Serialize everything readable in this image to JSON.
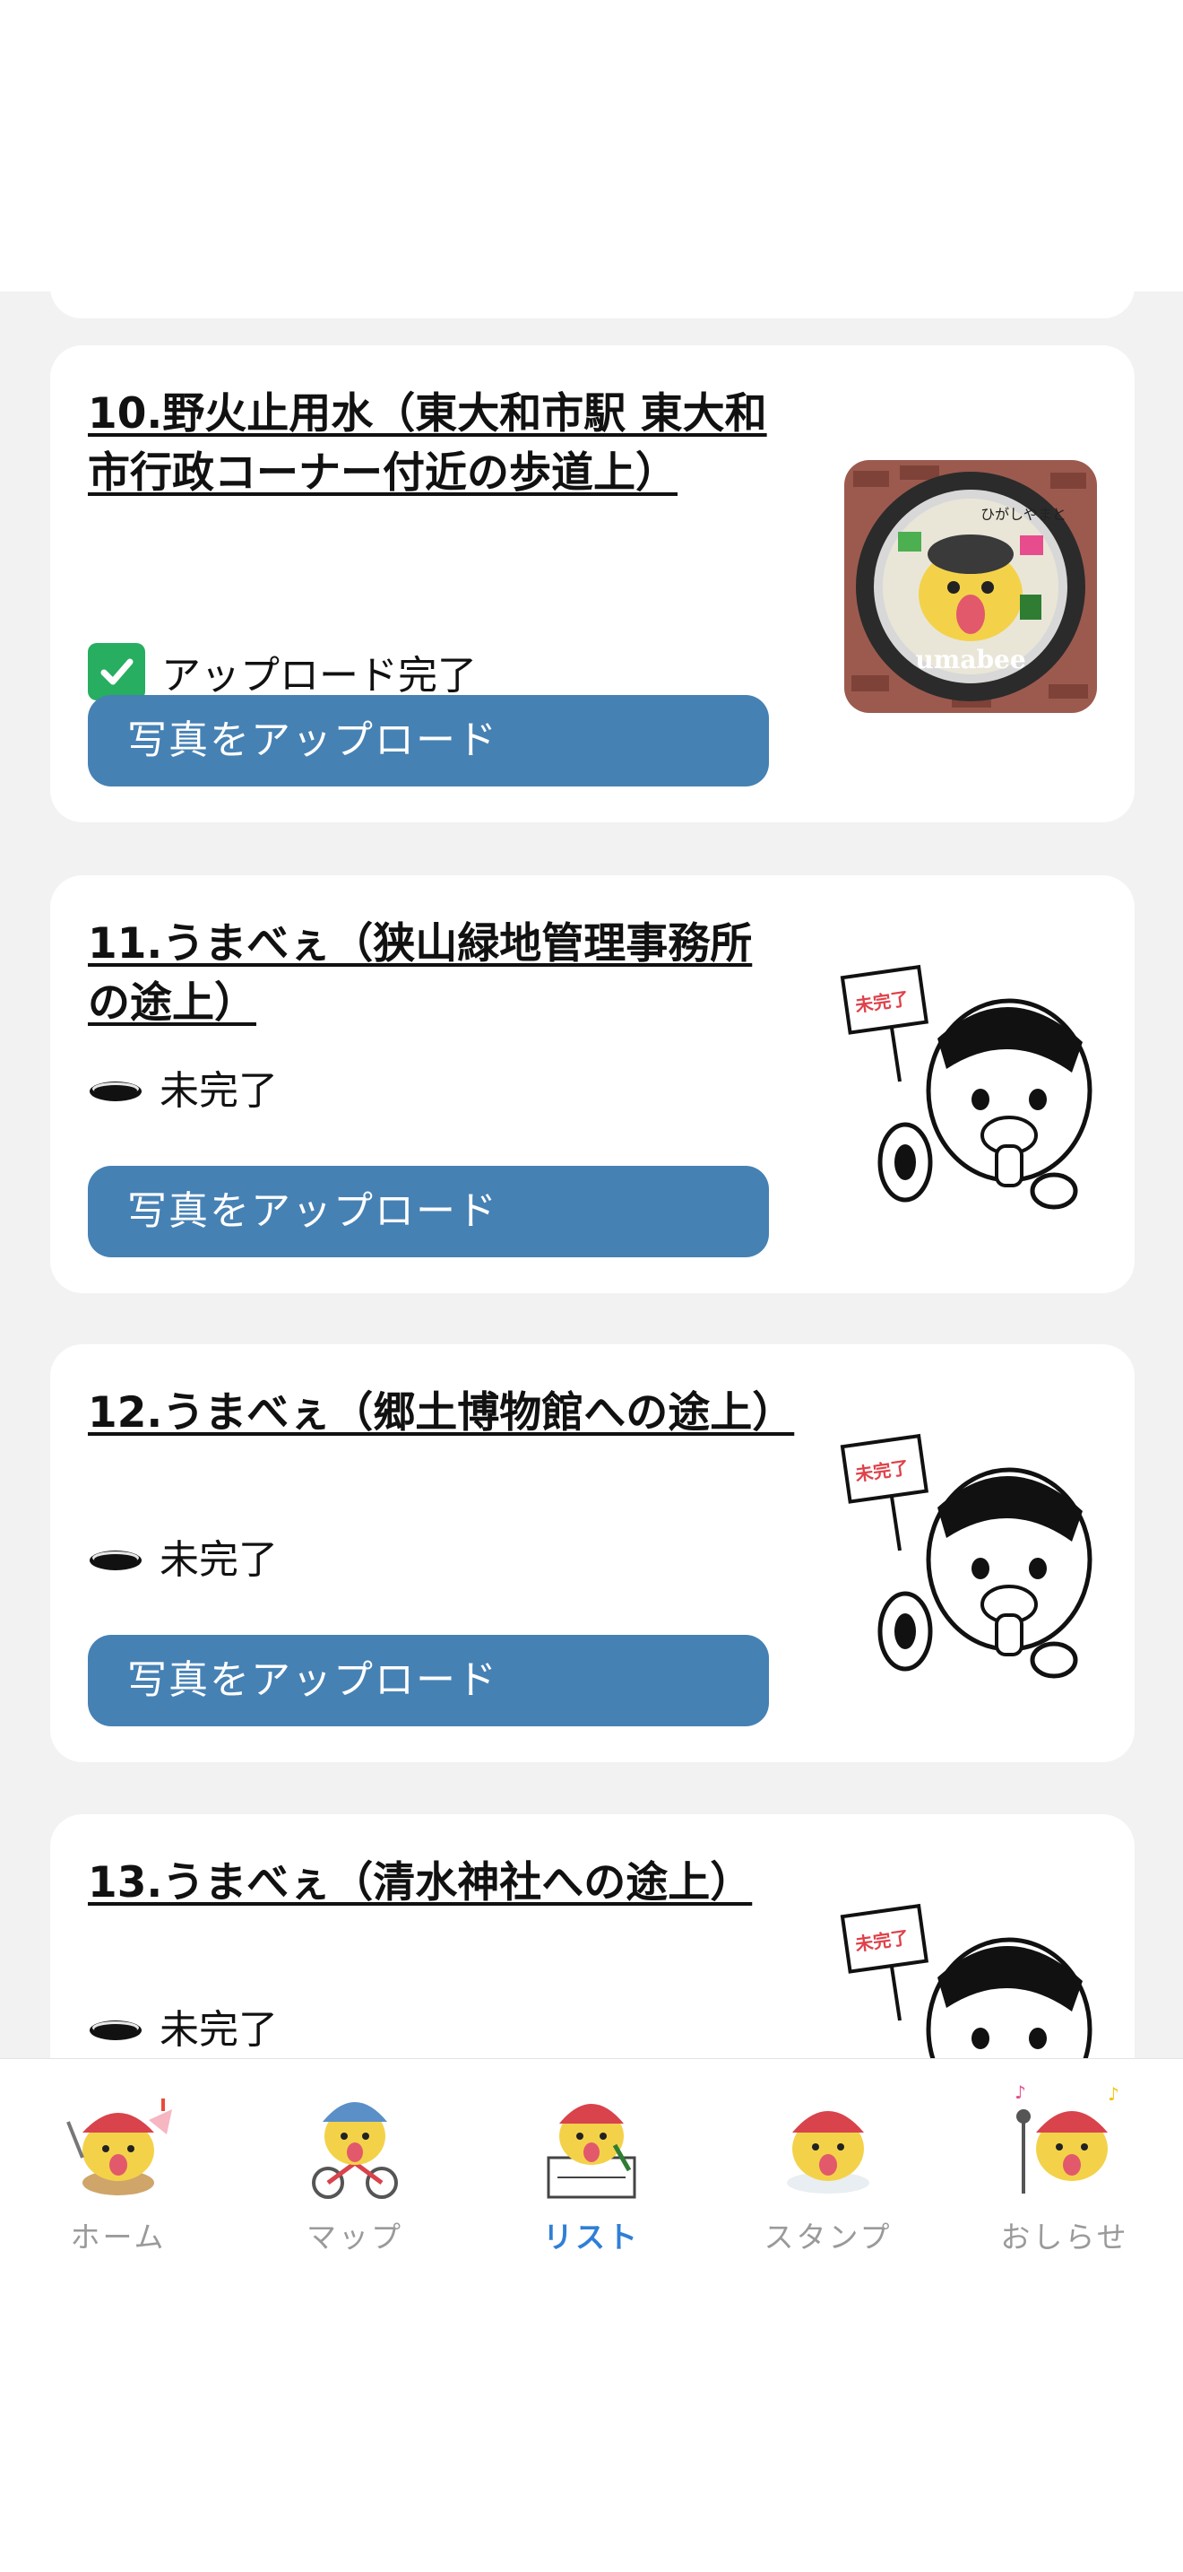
{
  "cards": [
    {
      "title": "10.野火止用水（東大和市駅 東大和市行政コーナー付近の歩道上）",
      "status": "アップロード完了",
      "status_icon": "check-icon",
      "button": "写真をアップロード",
      "thumbnail_text": "umabee",
      "thumbnail_arc": "ひがしやまと"
    },
    {
      "title": "11.うまべぇ（狭山緑地管理事務所の途上）",
      "status": "未完了",
      "status_icon": "manhole-icon",
      "button": "写真をアップロード",
      "flag_text": "未完了"
    },
    {
      "title": "12.うまべぇ（郷土博物館への途上）",
      "status": "未完了",
      "status_icon": "manhole-icon",
      "button": "写真をアップロード",
      "flag_text": "未完了"
    },
    {
      "title": "13.うまべぇ（清水神社への途上）",
      "status": "未完了",
      "status_icon": "manhole-icon",
      "flag_text": "未完了"
    }
  ],
  "tabs": [
    {
      "label": "ホーム",
      "icon": "home-mascot-icon",
      "active": false
    },
    {
      "label": "マップ",
      "icon": "map-mascot-icon",
      "active": false
    },
    {
      "label": "リスト",
      "icon": "list-mascot-icon",
      "active": true
    },
    {
      "label": "スタンプ",
      "icon": "stamp-mascot-icon",
      "active": false
    },
    {
      "label": "おしらせ",
      "icon": "news-mascot-icon",
      "active": false
    }
  ],
  "colors": {
    "button": "#4681b4",
    "active_tab": "#2f7fd6",
    "inactive_tab": "#9a9a9a",
    "background": "#f2f2f2"
  }
}
